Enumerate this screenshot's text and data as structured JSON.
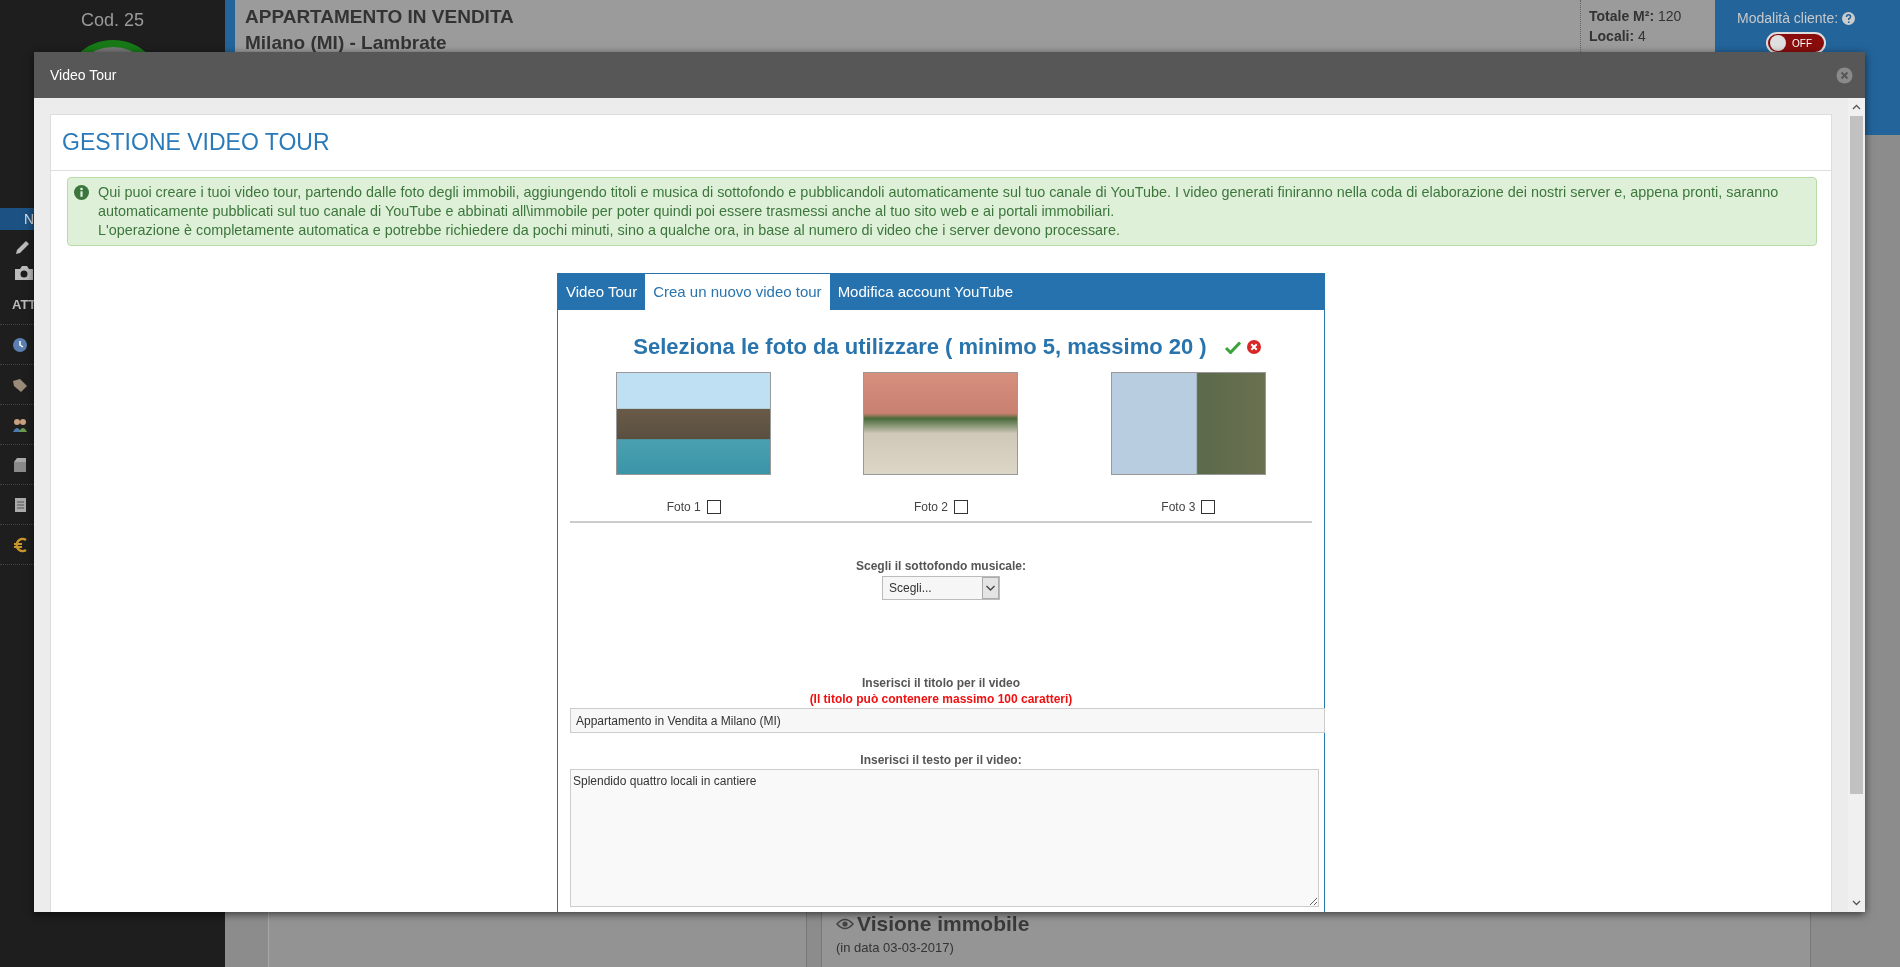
{
  "sidebar": {
    "code": "Cod. 25",
    "active_item": "N",
    "section_label": "ATT"
  },
  "listing_header": {
    "title": "APPARTAMENTO IN VENDITA",
    "location": "Milano (MI) - Lambrate",
    "area_label": "Totale M²:",
    "area": "120",
    "rooms_label": "Locali:",
    "rooms": "4"
  },
  "client_mode": {
    "label": "Modalità cliente:",
    "toggle_text": "OFF",
    "on": false
  },
  "background_section": {
    "title": "Visione immobile",
    "date": "(in data 03-03-2017)"
  },
  "dialog": {
    "title": "Video Tour",
    "heading": "GESTIONE VIDEO TOUR",
    "info": [
      "Qui puoi creare i tuoi video tour, partendo dalle foto degli immobili, aggiungendo titoli e musica di sottofondo e pubblicandoli automaticamente sul tuo canale di YouTube. I video generati finiranno nella coda di elaborazione dei nostri server e, appena pronti, saranno automaticamente pubblicati sul tuo canale di YouTube e abbinati all\\immobile per poter quindi poi essere trasmessi anche al tuo sito web e ai portali immobiliari.",
      "L'operazione è completamente automatica e potrebbe richiedere da pochi minuti, sino a qualche ora, in base al numero di video che i server devono processare."
    ],
    "tabs": [
      {
        "label": "Video Tour",
        "selected": false
      },
      {
        "label": "Crea un nuovo video tour",
        "selected": true
      },
      {
        "label": "Modifica account YouTube",
        "selected": false
      }
    ],
    "photo_heading": "Seleziona le foto da utilizzare ( minimo 5, massimo 20 )",
    "photos": [
      {
        "label": "Foto 1",
        "checked": false
      },
      {
        "label": "Foto 2",
        "checked": false
      },
      {
        "label": "Foto 3",
        "checked": false
      }
    ],
    "music": {
      "label": "Scegli il sottofondo musicale:",
      "value": "Scegli..."
    },
    "title_field": {
      "label": "Inserisci il titolo per il video",
      "note": "(Il titolo può contenere massimo 100 caratteri)",
      "value": "Appartamento in Vendita a Milano (MI)"
    },
    "text_field": {
      "label": "Inserisci il testo per il video:",
      "value": "Splendido quattro locali in cantiere"
    }
  }
}
